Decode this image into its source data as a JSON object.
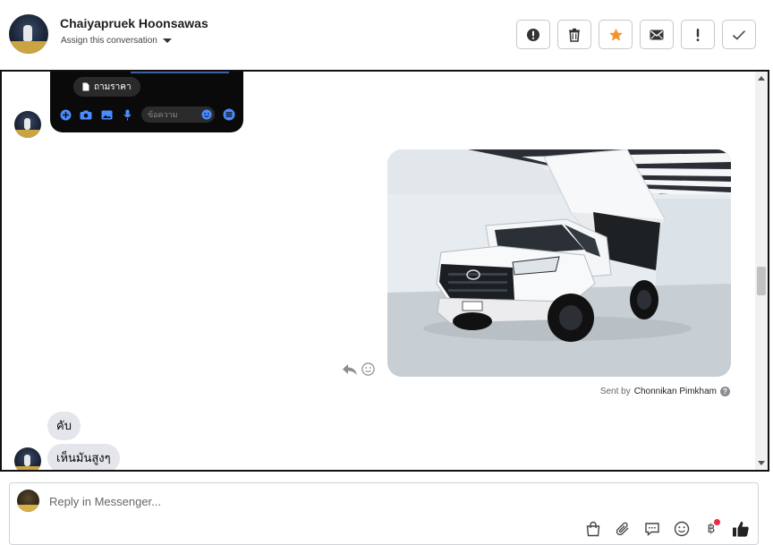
{
  "header": {
    "contact_name": "Chaiyapruek Hoonsawas",
    "assign_label": "Assign this conversation"
  },
  "actions": [
    {
      "name": "mark-spam",
      "icon": "exclamation-circle-icon"
    },
    {
      "name": "delete",
      "icon": "trash-icon"
    },
    {
      "name": "star",
      "icon": "star-icon",
      "color": "#f5932a"
    },
    {
      "name": "mark-unread",
      "icon": "envelope-icon"
    },
    {
      "name": "follow-up",
      "icon": "exclamation-icon"
    },
    {
      "name": "mark-done",
      "icon": "check-icon"
    }
  ],
  "conversation": {
    "phone_screenshot": {
      "chip_label": "ถามราคา",
      "input_placeholder": "ข้อความ"
    },
    "sent_by_prefix": "Sent by",
    "sent_by_name": "Chonnikan Pimkham",
    "messages": [
      {
        "text": "คับ"
      },
      {
        "text": "เห็นมันสูงๆ"
      }
    ]
  },
  "composer": {
    "placeholder": "Reply in Messenger..."
  },
  "colors": {
    "accent": "#f5932a",
    "notification_dot": "#f02849",
    "bubble_bg": "#e4e6eb"
  }
}
